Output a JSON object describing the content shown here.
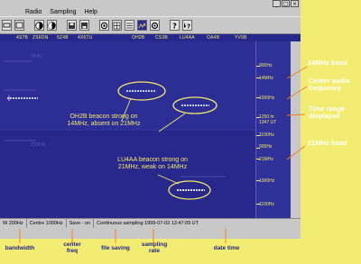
{
  "window": {
    "menu": [
      "Radio",
      "Sampling",
      "Help"
    ],
    "controls": [
      "_",
      "□",
      "×"
    ]
  },
  "callsigns": [
    "4S7B",
    "ZS6DN",
    "5Z4B",
    "4X6TU",
    "OH2B",
    "CS3B",
    "LU4AA",
    "OA4B",
    "YV5B"
  ],
  "scale": {
    "labels": [
      "900Hz",
      "14MHz",
      "1000Hz",
      "1250 hr\n1347 UT",
      "1100Hz",
      "900Hz",
      "21MHz",
      "1000Hz",
      "1100Hz"
    ]
  },
  "faint_labels": [
    "7R4U",
    "ZS6DN"
  ],
  "spectrogram_notes": {
    "note1": "OH2B beacon strong on\n14MHz, absent on 21MHz",
    "note2": "LU4AA beacon strong on\n21MHz, weak on 14MHz"
  },
  "status": {
    "items": [
      "W 200Hz",
      "Centre 1000Hz",
      "Save - on",
      "Continuous sampling 1999-07-03 13:47:09 UT"
    ]
  },
  "annotations_right": {
    "band14": "14MHz band",
    "center": "Center audio\nfrequency",
    "timerange": "Time range\ndisplayed",
    "band21": "21MHz band"
  },
  "annotations_bottom": {
    "bandwidth": "bandwidth",
    "center_freq": "center\nfreq",
    "file_saving": "file saving",
    "sampling_rate": "sampling\nrate",
    "date_time": "date time"
  },
  "colors": {
    "background": "#f3ec72",
    "spectrogram": "#2b2b92",
    "label_yellow": "#f0e86a",
    "annotation_white": "#ffffff",
    "annotation_blue": "#1e1e8c",
    "pointer_orange": "#f08020"
  }
}
